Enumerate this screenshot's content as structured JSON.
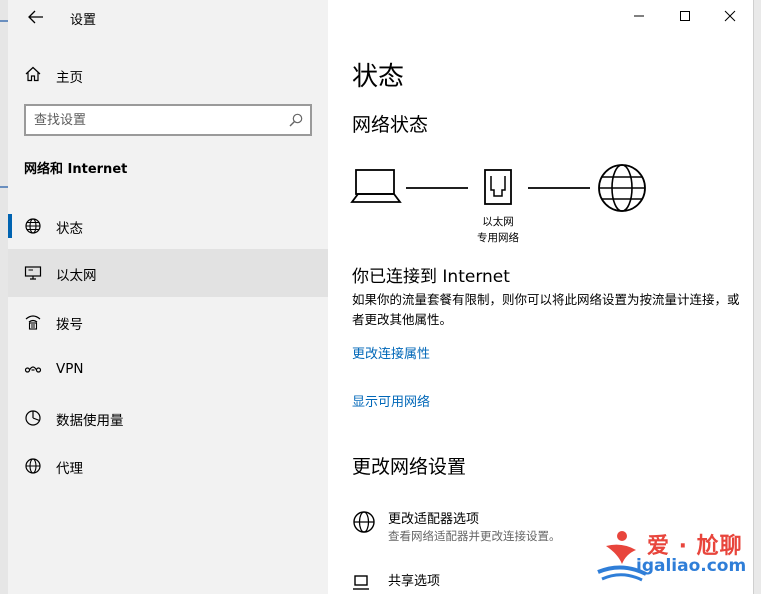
{
  "window": {
    "title": "设置",
    "back_icon": "back-arrow-icon",
    "controls": [
      "minimize",
      "maximize",
      "close"
    ]
  },
  "sidebar": {
    "home_label": "主页",
    "search_placeholder": "查找设置",
    "section_title": "网络和 Internet",
    "items": [
      {
        "label": "状态",
        "icon": "globe-icon",
        "selected": true
      },
      {
        "label": "以太网",
        "icon": "ethernet-icon",
        "selected": false
      },
      {
        "label": "拨号",
        "icon": "dialup-icon",
        "selected": false
      },
      {
        "label": "VPN",
        "icon": "vpn-icon",
        "selected": false
      },
      {
        "label": "数据使用量",
        "icon": "data-usage-icon",
        "selected": false
      },
      {
        "label": "代理",
        "icon": "proxy-globe-icon",
        "selected": false
      }
    ]
  },
  "main": {
    "title": "状态",
    "network_status_heading": "网络状态",
    "diagram": {
      "device_icon": "laptop-icon",
      "adapter_icon": "ethernet-port-icon",
      "internet_icon": "globe-icon",
      "adapter_label_line1": "以太网",
      "adapter_label_line2": "专用网络"
    },
    "connected_title": "你已连接到 Internet",
    "connected_desc": "如果你的流量套餐有限制，则你可以将此网络设置为按流量计连接，或者更改其他属性。",
    "link_change_props": "更改连接属性",
    "link_show_networks": "显示可用网络",
    "change_settings_heading": "更改网络设置",
    "options": [
      {
        "title": "更改适配器选项",
        "subtitle": "查看网络适配器并更改连接设置。",
        "icon": "adapter-globe-icon"
      },
      {
        "title": "共享选项",
        "subtitle": "",
        "icon": "sharing-icon"
      }
    ]
  },
  "watermark": {
    "text_cn": "爱 · 尬聊",
    "text_en": "igaliao.com"
  },
  "colors": {
    "accent": "#0063b1",
    "link": "#0067b8",
    "sidebar_bg": "#f2f2f2",
    "selected_bg": "#e2e2e2",
    "watermark_red": "#e8453c",
    "watermark_blue": "#2f7ed8"
  }
}
